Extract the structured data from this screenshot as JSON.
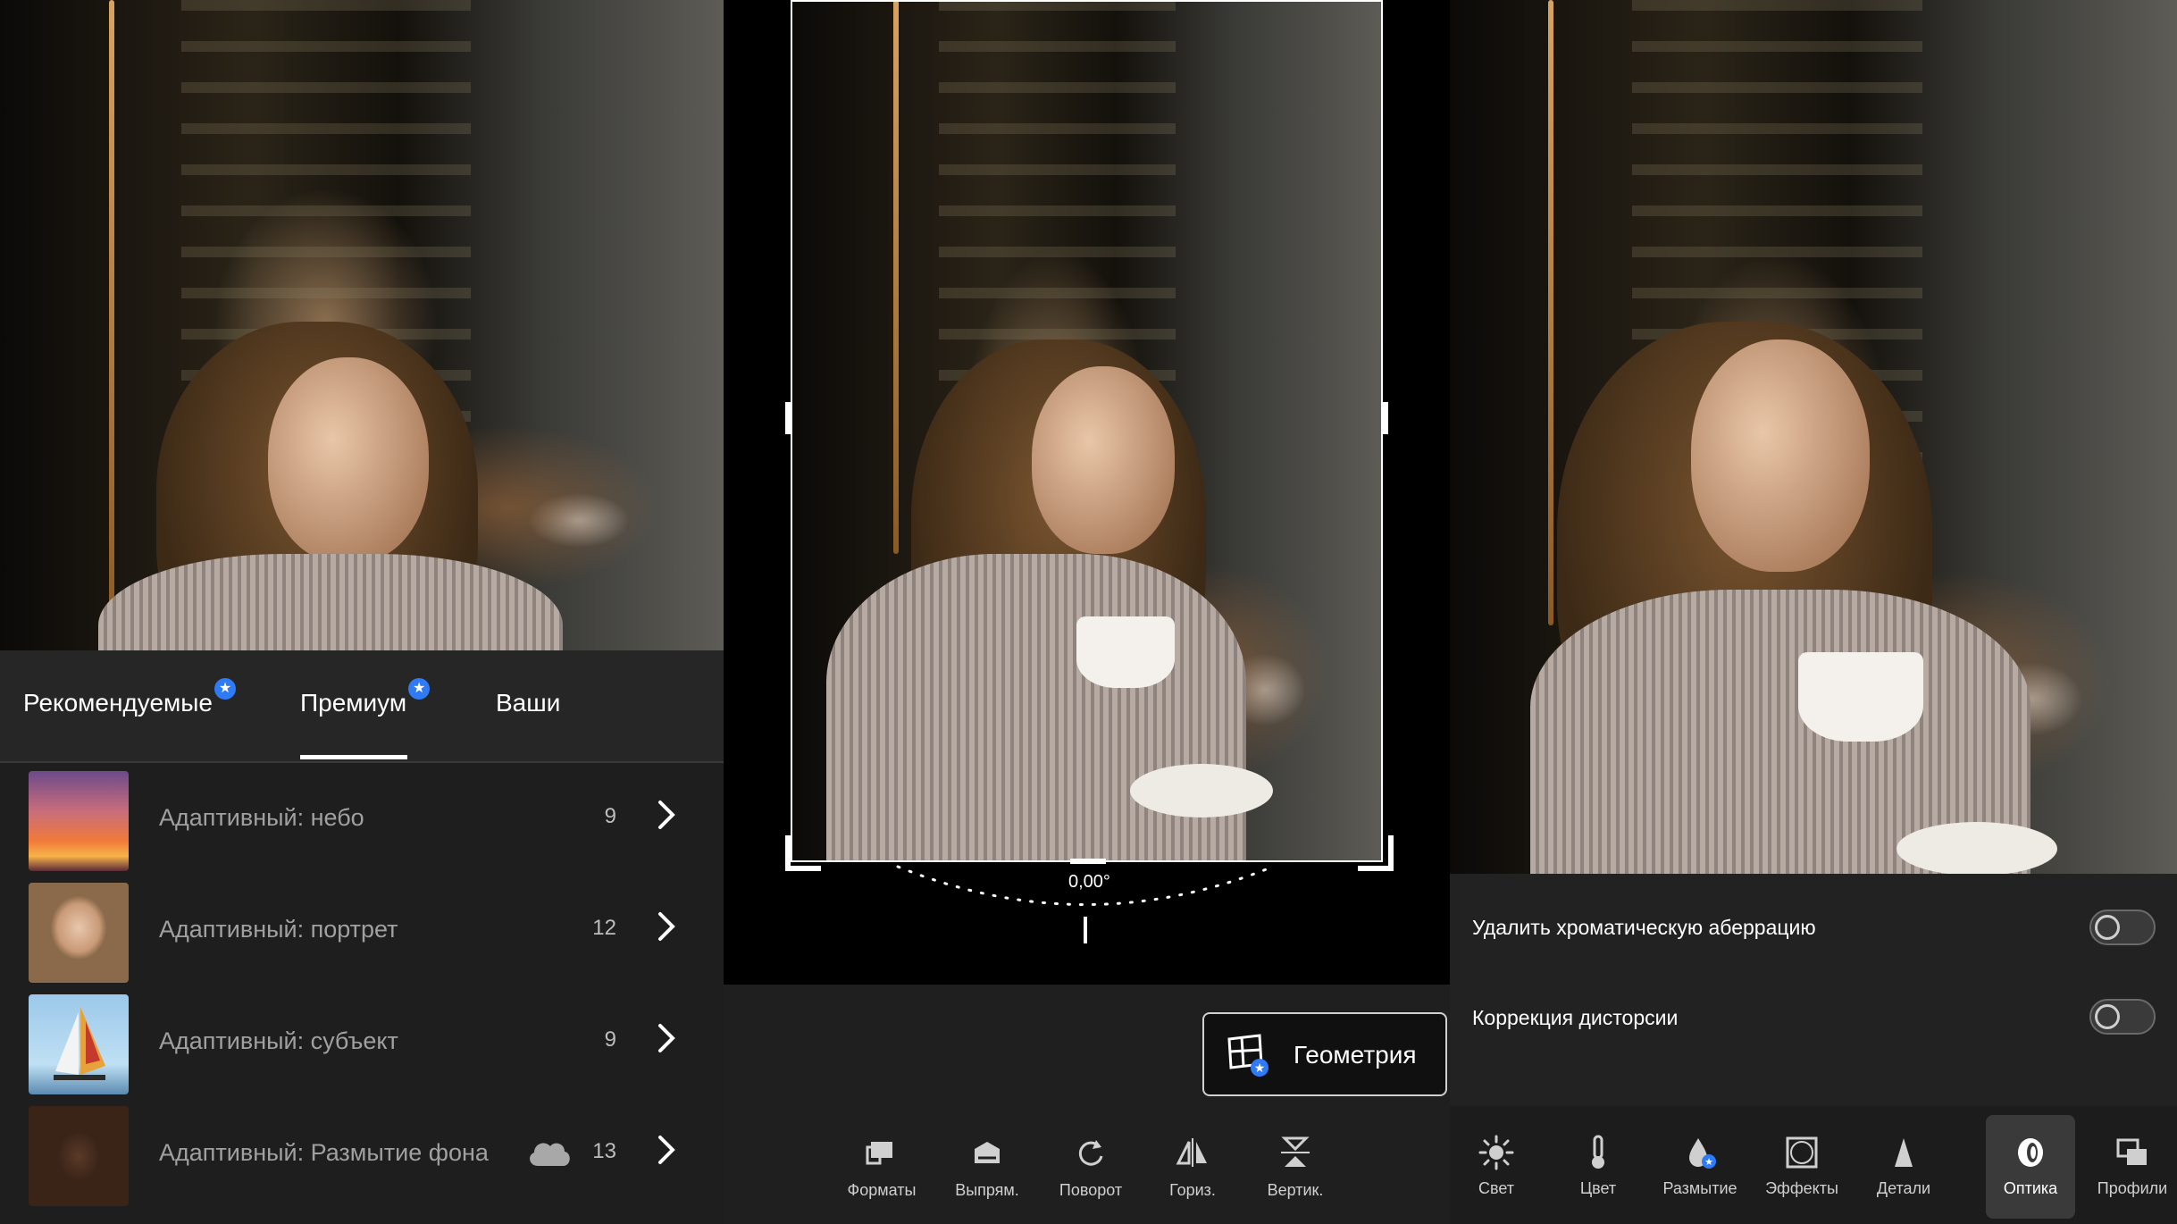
{
  "left": {
    "tabs": [
      {
        "label": "Рекомендуемые",
        "badge": true
      },
      {
        "label": "Премиум",
        "badge": true,
        "active": true
      },
      {
        "label": "Ваши",
        "badge": false
      }
    ],
    "presets": [
      {
        "label": "Адаптивный: небо",
        "count": "9",
        "cloud": false
      },
      {
        "label": "Адаптивный: портрет",
        "count": "12",
        "cloud": false
      },
      {
        "label": "Адаптивный: субъект",
        "count": "9",
        "cloud": false
      },
      {
        "label": "Адаптивный: Размытие фона",
        "count": "13",
        "cloud": true
      }
    ]
  },
  "middle": {
    "angle": "0,00°",
    "geometry_button": "Геометрия",
    "tools": [
      "Форматы",
      "Выпрям.",
      "Поворот",
      "Гориз.",
      "Вертик."
    ]
  },
  "right": {
    "options": [
      {
        "label": "Удалить хроматическую аберрацию",
        "on": false
      },
      {
        "label": "Коррекция дисторсии",
        "on": false
      }
    ],
    "tools": [
      {
        "label": "Свет",
        "icon": "sun-icon"
      },
      {
        "label": "Цвет",
        "icon": "thermometer-icon"
      },
      {
        "label": "Размытие",
        "icon": "drop-icon"
      },
      {
        "label": "Эффекты",
        "icon": "vignette-icon"
      },
      {
        "label": "Детали",
        "icon": "triangle-icon"
      },
      {
        "label": "Оптика",
        "icon": "lens-icon",
        "active": true
      },
      {
        "label": "Профили",
        "icon": "profiles-icon"
      }
    ]
  },
  "colors": {
    "accent": "#2f7af5",
    "panel": "#1e1e1e"
  }
}
